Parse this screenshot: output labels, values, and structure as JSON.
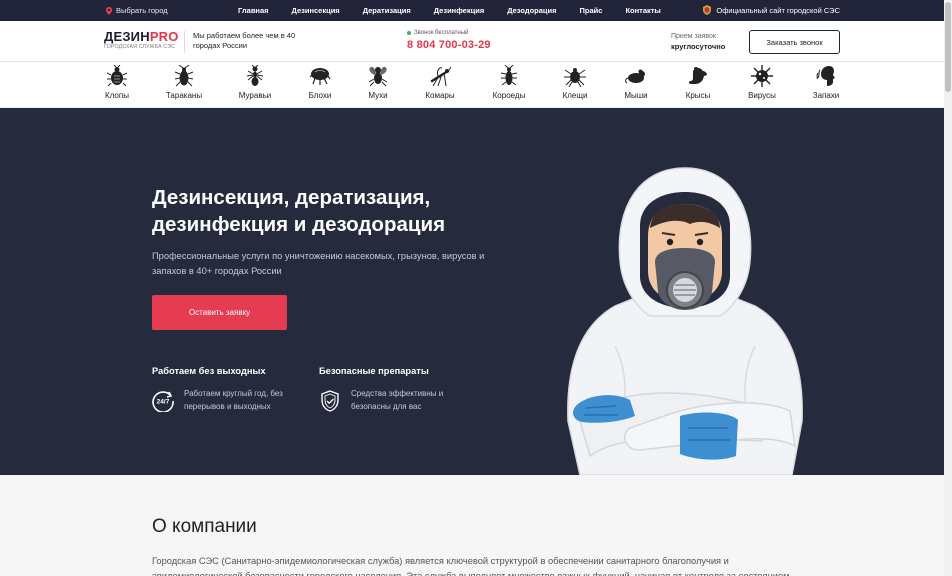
{
  "topbar": {
    "city": "Выбрать город",
    "nav": [
      "Главная",
      "Дезинсекция",
      "Дератизация",
      "Дезинфекция",
      "Дезодорация",
      "Прайс",
      "Контакты"
    ],
    "official": "Официальный сайт городской СЭС"
  },
  "header": {
    "logo_main": "ДЕЗИН",
    "logo_accent": "PRO",
    "logo_sub": "ГОРОДСКАЯ СЛУЖБА СЭС",
    "cities_note": "Мы работаем более чем в 40 городах России",
    "free_call_label": "Звонок бесплатный",
    "phone": "8 804 700-03-29",
    "receive_label": "Прием заявок:",
    "receive_value": "круглосуточно",
    "callback_button": "Заказать звонок"
  },
  "categories": [
    {
      "label": "Клопы",
      "icon": "bedbug-icon"
    },
    {
      "label": "Тараканы",
      "icon": "cockroach-icon"
    },
    {
      "label": "Муравьи",
      "icon": "ant-icon"
    },
    {
      "label": "Блохи",
      "icon": "flea-icon"
    },
    {
      "label": "Мухи",
      "icon": "fly-icon"
    },
    {
      "label": "Комары",
      "icon": "mosquito-icon"
    },
    {
      "label": "Короеды",
      "icon": "bark-beetle-icon"
    },
    {
      "label": "Клещи",
      "icon": "tick-icon"
    },
    {
      "label": "Мыши",
      "icon": "mouse-icon"
    },
    {
      "label": "Крысы",
      "icon": "rat-icon"
    },
    {
      "label": "Вирусы",
      "icon": "virus-icon"
    },
    {
      "label": "Запахи",
      "icon": "smell-icon"
    }
  ],
  "hero": {
    "title": "Дезинсекция, дератизация, дезинфекция и дезодорация",
    "lead": "Профессиональные услуги по уничтожению насекомых, грызунов, вирусов и запахов в 40+ городах России",
    "cta": "Оставить заявку",
    "features": [
      {
        "title": "Работаем без выходных",
        "text": "Работаем круглый год, без перерывов и выходных",
        "icon": "clock-24-7-icon"
      },
      {
        "title": "Безопасные препараты",
        "text": "Средства эффективны и безопасны для вас",
        "icon": "shield-check-icon"
      }
    ]
  },
  "about": {
    "title": "О компании",
    "text": "Городская СЭС (Санитарно-эпидемиологическая служба) является ключевой структурой в обеспечении санитарного благополучия и эпидемиологической безопасности городского населения. Эта служба выполняет множество важных функций, начиная от контроля за состоянием"
  },
  "colors": {
    "accent": "#e63c51",
    "dark": "#262a3d",
    "topbar": "#22253a"
  }
}
